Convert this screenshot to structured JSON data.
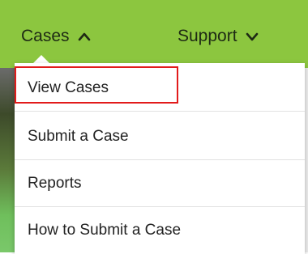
{
  "nav": {
    "cases_label": "Cases",
    "support_label": "Support",
    "brand_color": "#8cc63f"
  },
  "menu": {
    "items": [
      {
        "label": "View Cases"
      },
      {
        "label": "Submit a Case"
      },
      {
        "label": "Reports"
      },
      {
        "label": "How to Submit a Case"
      }
    ],
    "highlighted_index": 0,
    "highlight_color": "#e21b1b"
  },
  "icons": {
    "cases_chevron": "chevron-up-icon",
    "support_chevron": "chevron-down-icon"
  }
}
